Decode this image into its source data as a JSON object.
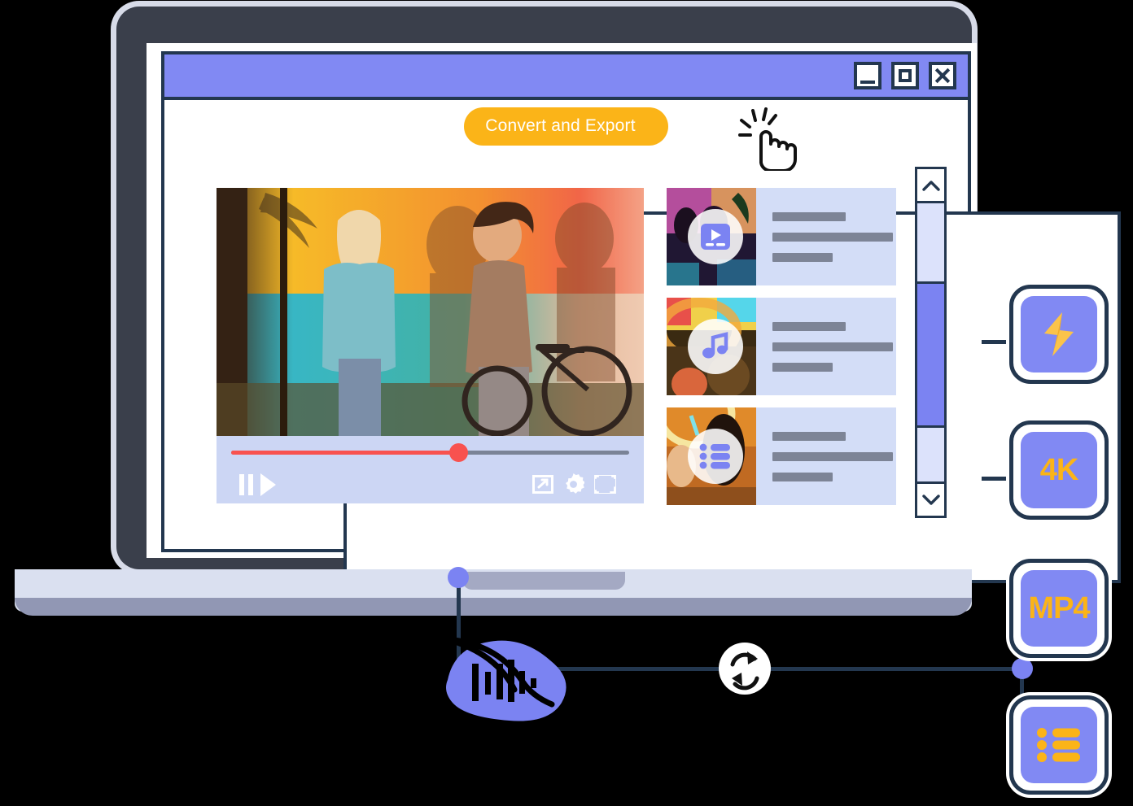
{
  "app": {
    "title_bar": {
      "window_controls": [
        {
          "name": "minimize",
          "label": "Minimize"
        },
        {
          "name": "maximize",
          "label": "Maximize"
        },
        {
          "name": "close",
          "label": "Close"
        }
      ]
    },
    "toolbar": {
      "convert_label": "Convert and Export",
      "cursor_icon": "pointing-hand-click-icon"
    },
    "player": {
      "play_icon": "play-icon",
      "progress_percent": 57,
      "progress_color": "#f8524f",
      "controls_left": [
        {
          "name": "pause",
          "icon": "pause-icon"
        },
        {
          "name": "play",
          "icon": "play-icon"
        }
      ],
      "controls_right": [
        {
          "name": "miniplayer",
          "icon": "miniplayer-icon"
        },
        {
          "name": "settings",
          "icon": "gear-icon"
        },
        {
          "name": "fullscreen",
          "icon": "fullscreen-icon"
        }
      ]
    },
    "playlist": {
      "items": [
        {
          "icon": "video-file-icon",
          "lines": 3
        },
        {
          "icon": "music-note-icon",
          "lines": 3
        },
        {
          "icon": "playlist-list-icon",
          "lines": 3
        }
      ]
    },
    "scrollbar": {
      "up_icon": "chevron-up-icon",
      "down_icon": "chevron-down-icon",
      "thumb_position_percent": 32
    }
  },
  "features": [
    {
      "name": "speed",
      "icon": "lightning-bolt-icon",
      "label": ""
    },
    {
      "name": "4k",
      "icon": "text-badge",
      "label": "4K"
    },
    {
      "name": "mp4",
      "icon": "text-badge",
      "label": "MP4"
    },
    {
      "name": "batch",
      "icon": "bullet-list-icon",
      "label": ""
    }
  ],
  "diagram": {
    "audio_node_icon": "audio-waveform-icon",
    "sync_node_icon": "sync-refresh-icon"
  },
  "colors": {
    "accent_purple": "#8189f3",
    "accent_amber": "#fbb418",
    "outline_navy": "#23374f",
    "progress_red": "#f8524f",
    "panel_blue": "#d3ddf7",
    "laptop_body": "#3a3f4b"
  }
}
